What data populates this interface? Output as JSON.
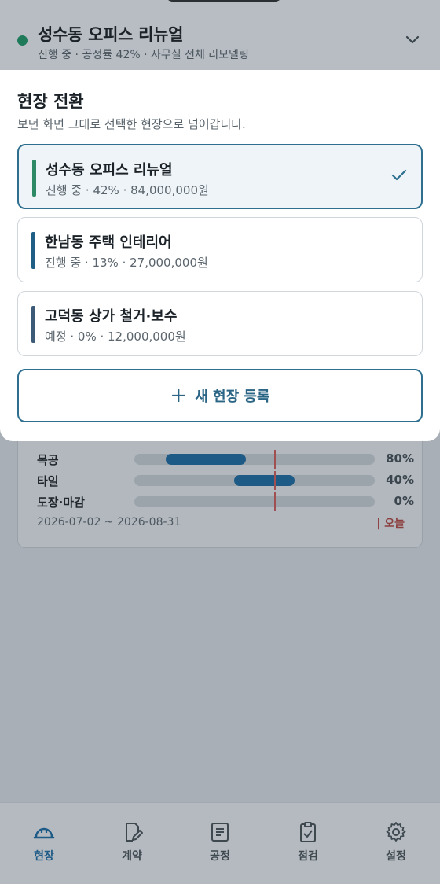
{
  "header": {
    "title": "성수동 오피스 리뉴얼",
    "subtitle": "진행 중 · 공정률 42% · 사무실 전체 리모델링",
    "status_color": "#1f7a5a"
  },
  "gantt": {
    "rows": [
      {
        "label": "목공",
        "progress_pct": "80%"
      },
      {
        "label": "타일",
        "progress_pct": "40%"
      },
      {
        "label": "도장·마감",
        "progress_pct": "0%"
      }
    ],
    "date_range": "2026-07-02 ~ 2026-08-31",
    "today_legend": "| 오늘"
  },
  "sheet": {
    "title": "현장 전환",
    "description": "보던 화면 그대로 선택한 현장으로 넘어갑니다.",
    "sites": [
      {
        "name": "성수동 오피스 리뉴얼",
        "meta": "진행 중 · 42% · 84,000,000원",
        "accent": "#2e8a66",
        "selected": true
      },
      {
        "name": "한남동 주택 인테리어",
        "meta": "진행 중 · 13% · 27,000,000원",
        "accent": "#1f5f86",
        "selected": false
      },
      {
        "name": "고덕동 상가 철거·보수",
        "meta": "예정 · 0% · 12,000,000원",
        "accent": "#3d5a78",
        "selected": false
      }
    ],
    "add_button": {
      "icon": "plus-icon",
      "label": "새 현장 등록"
    }
  },
  "nav": {
    "items": [
      {
        "label": "현장",
        "icon": "hardhat-icon",
        "active": true
      },
      {
        "label": "계약",
        "icon": "contract-edit-icon",
        "active": false
      },
      {
        "label": "공정",
        "icon": "schedule-list-icon",
        "active": false
      },
      {
        "label": "점검",
        "icon": "clipboard-check-icon",
        "active": false
      },
      {
        "label": "설정",
        "icon": "gear-icon",
        "active": false
      }
    ]
  },
  "colors": {
    "accent": "#2e6f8f",
    "nav_active": "#1d5a86",
    "today_marker": "#a05050"
  }
}
